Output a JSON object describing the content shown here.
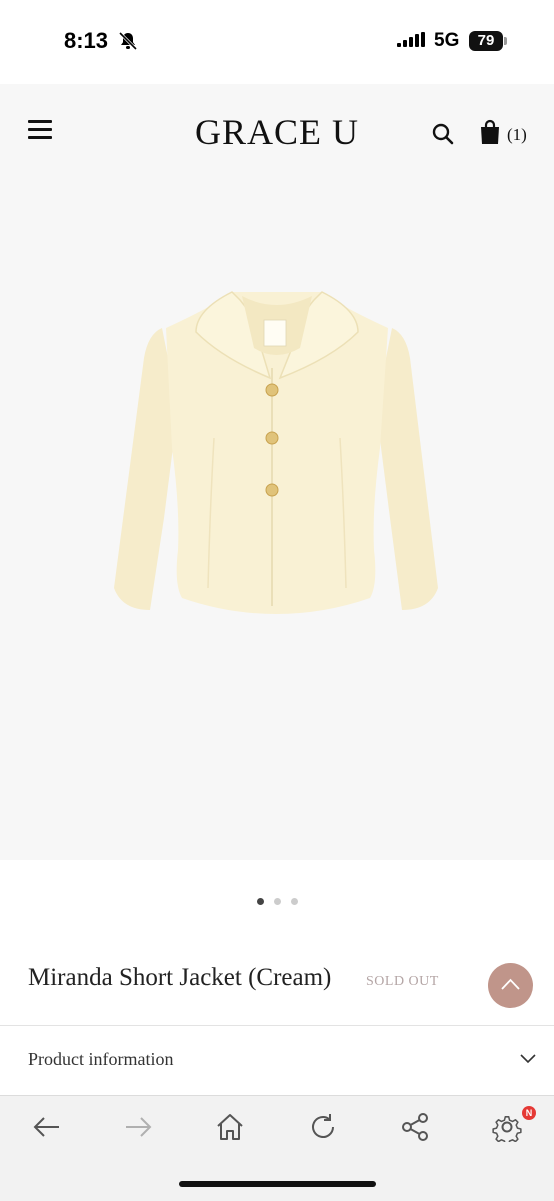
{
  "status_bar": {
    "time": "8:13",
    "network": "5G",
    "battery": "79"
  },
  "header": {
    "logo": "GRACE U",
    "cart_count": "(1)"
  },
  "gallery": {
    "total_images": 3,
    "active_index": 0
  },
  "product": {
    "title": "Miranda Short Jacket (Cream)",
    "status": "SOLD OUT"
  },
  "sections": {
    "product_information": "Product information"
  },
  "toolbar": {
    "items": [
      "back-arrow-icon",
      "forward-arrow-icon",
      "home-icon",
      "reload-icon",
      "share-icon",
      "settings-icon"
    ],
    "badge": "N"
  },
  "colors": {
    "accent": "#c0958a",
    "sold_out": "#b4a5a5",
    "badge": "#e53935",
    "jacket": "#f8f0d2"
  }
}
